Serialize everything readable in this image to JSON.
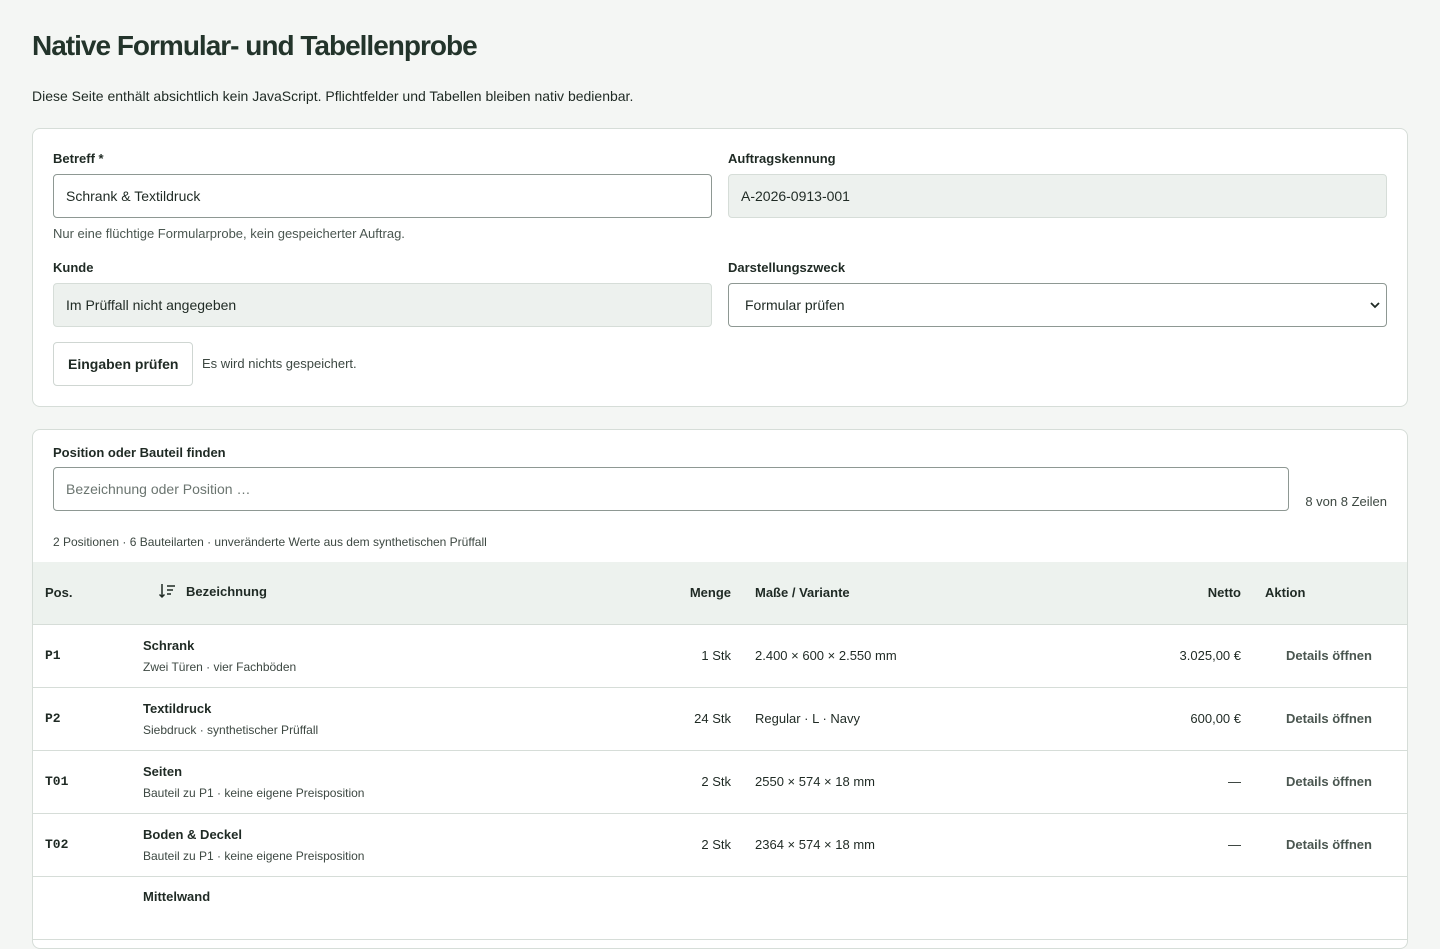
{
  "page": {
    "title": "Native Formular- und Tabellenprobe",
    "intro": "Diese Seite enthält absichtlich kein JavaScript. Pflichtfelder und Tabellen bleiben nativ bedienbar."
  },
  "form": {
    "betreff": {
      "label": "Betreff *",
      "value": "Schrank & Textildruck",
      "hint": "Nur eine flüchtige Formularprobe, kein gespeicherter Auftrag."
    },
    "auftrag": {
      "label": "Auftragskennung",
      "value": "A-2026-0913-001"
    },
    "kunde": {
      "label": "Kunde",
      "value": "Im Prüffall nicht angegeben"
    },
    "zweck": {
      "label": "Darstellungszweck",
      "value": "Formular prüfen"
    },
    "submit_label": "Eingaben prüfen",
    "submit_note": "Es wird nichts gespeichert."
  },
  "table_section": {
    "search_label": "Position oder Bauteil finden",
    "search_placeholder": "Bezeichnung oder Position …",
    "row_count": "8 von 8 Zeilen",
    "summary": "2 Positionen · 6 Bauteilarten · unveränderte Werte aus dem synthetischen Prüffall",
    "columns": {
      "pos": "Pos.",
      "name": "Bezeichnung",
      "qty": "Menge",
      "dims": "Maße / Variante",
      "net": "Netto",
      "action": "Aktion"
    },
    "rows": [
      {
        "pos": "P1",
        "name": "Schrank",
        "sub": "Zwei Türen · vier Fachböden",
        "qty": "1 Stk",
        "dims": "2.400 × 600 × 2.550 mm",
        "net": "3.025,00 €",
        "action": "Details öffnen"
      },
      {
        "pos": "P2",
        "name": "Textildruck",
        "sub": "Siebdruck · synthetischer Prüffall",
        "qty": "24 Stk",
        "dims": "Regular · L · Navy",
        "net": "600,00 €",
        "action": "Details öffnen"
      },
      {
        "pos": "T01",
        "name": "Seiten",
        "sub": "Bauteil zu P1 · keine eigene Preisposition",
        "qty": "2 Stk",
        "dims": "2550 × 574 × 18 mm",
        "net": "—",
        "action": "Details öffnen"
      },
      {
        "pos": "T02",
        "name": "Boden & Deckel",
        "sub": "Bauteil zu P1 · keine eigene Preisposition",
        "qty": "2 Stk",
        "dims": "2364 × 574 × 18 mm",
        "net": "—",
        "action": "Details öffnen"
      },
      {
        "pos": "",
        "name": "Mittelwand",
        "sub": "",
        "qty": "",
        "dims": "",
        "net": "",
        "action": ""
      }
    ]
  },
  "icons": {
    "sort": "sort-descending-icon",
    "select_chevron": "chevron-down-icon"
  }
}
